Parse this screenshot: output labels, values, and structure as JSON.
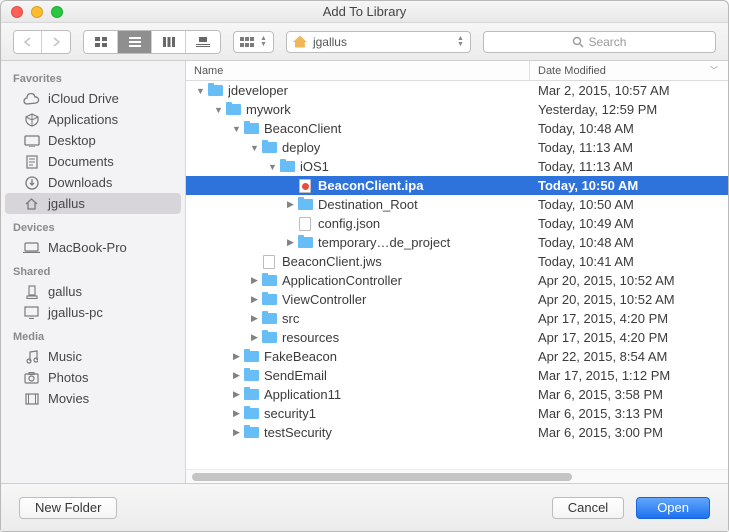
{
  "window": {
    "title": "Add To Library"
  },
  "toolbar": {
    "location_label": "jgallus",
    "search_placeholder": "Search"
  },
  "columns": {
    "name": "Name",
    "date": "Date Modified"
  },
  "sidebar": {
    "groups": [
      {
        "header": "Favorites",
        "items": [
          {
            "icon": "cloud",
            "label": "iCloud Drive"
          },
          {
            "icon": "app",
            "label": "Applications"
          },
          {
            "icon": "desktop",
            "label": "Desktop"
          },
          {
            "icon": "doc",
            "label": "Documents"
          },
          {
            "icon": "download",
            "label": "Downloads"
          },
          {
            "icon": "home",
            "label": "jgallus",
            "selected": true
          }
        ]
      },
      {
        "header": "Devices",
        "items": [
          {
            "icon": "laptop",
            "label": "MacBook-Pro"
          }
        ]
      },
      {
        "header": "Shared",
        "items": [
          {
            "icon": "net",
            "label": "gallus"
          },
          {
            "icon": "netpc",
            "label": "jgallus-pc"
          }
        ]
      },
      {
        "header": "Media",
        "items": [
          {
            "icon": "music",
            "label": "Music"
          },
          {
            "icon": "photo",
            "label": "Photos"
          },
          {
            "icon": "movie",
            "label": "Movies"
          }
        ]
      }
    ]
  },
  "rows": [
    {
      "depth": 0,
      "expanded": true,
      "type": "folder",
      "name": "jdeveloper",
      "date": "Mar 2, 2015, 10:57 AM"
    },
    {
      "depth": 1,
      "expanded": true,
      "type": "folder",
      "name": "mywork",
      "date": "Yesterday, 12:59 PM"
    },
    {
      "depth": 2,
      "expanded": true,
      "type": "folder",
      "name": "BeaconClient",
      "date": "Today, 10:48 AM"
    },
    {
      "depth": 3,
      "expanded": true,
      "type": "folder",
      "name": "deploy",
      "date": "Today, 11:13 AM"
    },
    {
      "depth": 4,
      "expanded": true,
      "type": "folder",
      "name": "iOS1",
      "date": "Today, 11:13 AM"
    },
    {
      "depth": 5,
      "expanded": null,
      "type": "file-red",
      "name": "BeaconClient.ipa",
      "date": "Today, 10:50 AM",
      "selected": true
    },
    {
      "depth": 5,
      "expanded": false,
      "type": "folder",
      "name": "Destination_Root",
      "date": "Today, 10:50 AM"
    },
    {
      "depth": 5,
      "expanded": null,
      "type": "file",
      "name": "config.json",
      "date": "Today, 10:49 AM"
    },
    {
      "depth": 5,
      "expanded": false,
      "type": "folder",
      "name": "temporary…de_project",
      "date": "Today, 10:48 AM"
    },
    {
      "depth": 3,
      "expanded": null,
      "type": "file",
      "name": "BeaconClient.jws",
      "date": "Today, 10:41 AM"
    },
    {
      "depth": 3,
      "expanded": false,
      "type": "folder",
      "name": "ApplicationController",
      "date": "Apr 20, 2015, 10:52 AM"
    },
    {
      "depth": 3,
      "expanded": false,
      "type": "folder",
      "name": "ViewController",
      "date": "Apr 20, 2015, 10:52 AM"
    },
    {
      "depth": 3,
      "expanded": false,
      "type": "folder",
      "name": "src",
      "date": "Apr 17, 2015, 4:20 PM"
    },
    {
      "depth": 3,
      "expanded": false,
      "type": "folder",
      "name": "resources",
      "date": "Apr 17, 2015, 4:20 PM"
    },
    {
      "depth": 2,
      "expanded": false,
      "type": "folder",
      "name": "FakeBeacon",
      "date": "Apr 22, 2015, 8:54 AM"
    },
    {
      "depth": 2,
      "expanded": false,
      "type": "folder",
      "name": "SendEmail",
      "date": "Mar 17, 2015, 1:12 PM"
    },
    {
      "depth": 2,
      "expanded": false,
      "type": "folder",
      "name": "Application11",
      "date": "Mar 6, 2015, 3:58 PM"
    },
    {
      "depth": 2,
      "expanded": false,
      "type": "folder",
      "name": "security1",
      "date": "Mar 6, 2015, 3:13 PM"
    },
    {
      "depth": 2,
      "expanded": false,
      "type": "folder",
      "name": "testSecurity",
      "date": "Mar 6, 2015, 3:00 PM"
    }
  ],
  "footer": {
    "new_folder": "New Folder",
    "cancel": "Cancel",
    "open": "Open"
  }
}
